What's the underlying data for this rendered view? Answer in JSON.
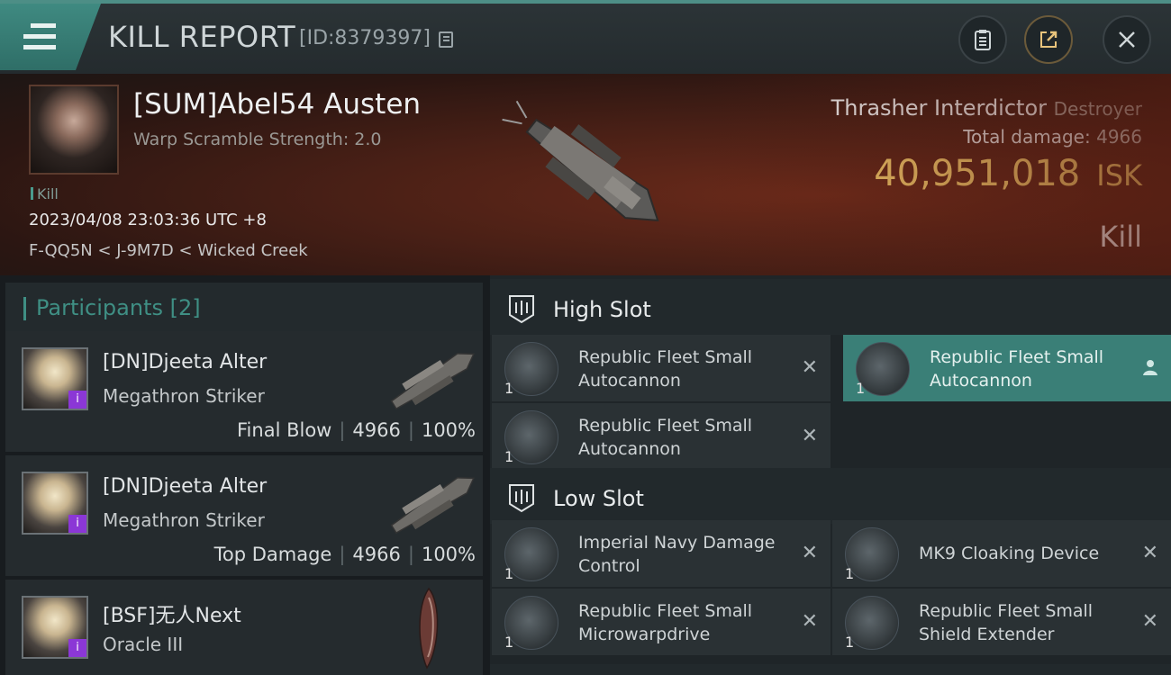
{
  "header": {
    "title": "KILL REPORT",
    "report_id": "[ID:8379397]",
    "buttons": [
      "report",
      "share",
      "close"
    ]
  },
  "victim": {
    "name": "[SUM]Abel54 Austen",
    "warp_scramble": "Warp Scramble Strength: 2.0",
    "tag": "Kill",
    "datetime": "2023/04/08 23:03:36 UTC +8",
    "location": "F-QQ5N < J-9M7D < Wicked Creek",
    "ship_name": "Thrasher Interdictor",
    "ship_class": "Destroyer",
    "total_damage_label": "Total damage:",
    "total_damage": "4966",
    "isk_value": "40,951,018",
    "isk_unit": "ISK",
    "result": "Kill"
  },
  "participants": {
    "header": "Participants [2]",
    "rows": [
      {
        "name": "[DN]Djeeta Alter",
        "ship": "Megathron Striker",
        "role": "Final Blow",
        "damage": "4966",
        "percent": "100%"
      },
      {
        "name": "[DN]Djeeta Alter",
        "ship": "Megathron Striker",
        "role": "Top Damage",
        "damage": "4966",
        "percent": "100%"
      },
      {
        "name": "[BSF]无人Next",
        "ship": "Oracle III"
      }
    ]
  },
  "slots": {
    "high": {
      "label": "High Slot",
      "items": [
        {
          "name": "Republic Fleet Small Autocannon",
          "qty": "1"
        },
        {
          "name": "Republic Fleet Small Autocannon",
          "qty": "1"
        },
        {
          "name": "Republic Fleet Small Autocannon",
          "qty": "1"
        }
      ]
    },
    "low": {
      "label": "Low Slot",
      "items": [
        {
          "name": "Imperial Navy Damage Control",
          "qty": "1"
        },
        {
          "name": "MK9 Cloaking Device",
          "qty": "1"
        },
        {
          "name": "Republic Fleet Small Microwarpdrive",
          "qty": "1"
        },
        {
          "name": "Republic Fleet Small Shield Extender",
          "qty": "1"
        }
      ]
    }
  },
  "colors": {
    "accent": "#3f8f84",
    "isk": "#f0c86a",
    "badge": "#8b37d6"
  }
}
